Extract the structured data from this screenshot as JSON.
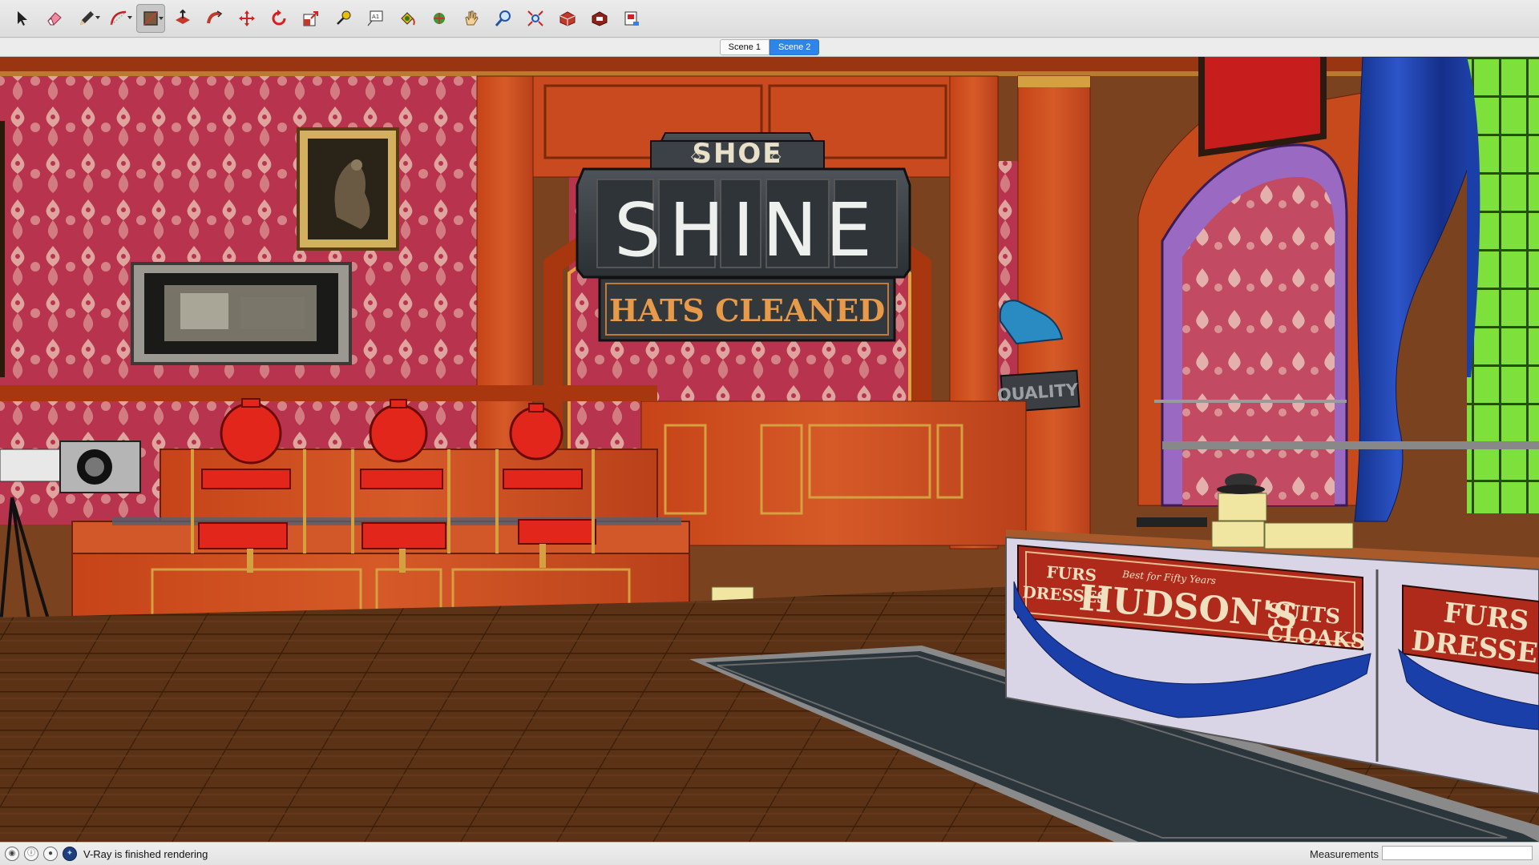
{
  "toolbar": {
    "tools": [
      {
        "name": "select",
        "icon": "select-arrow-icon"
      },
      {
        "name": "eraser",
        "icon": "eraser-icon"
      },
      {
        "name": "line",
        "icon": "pencil-line-icon"
      },
      {
        "name": "arc",
        "icon": "arc-icon"
      },
      {
        "name": "shapes",
        "icon": "rectangle-shape-icon"
      },
      {
        "name": "push-pull",
        "icon": "push-pull-icon"
      },
      {
        "name": "follow-me",
        "icon": "follow-me-icon"
      },
      {
        "name": "move",
        "icon": "move-arrows-icon"
      },
      {
        "name": "rotate",
        "icon": "rotate-icon"
      },
      {
        "name": "scale",
        "icon": "scale-icon"
      },
      {
        "name": "tape-measure",
        "icon": "tape-measure-icon"
      },
      {
        "name": "text",
        "icon": "text-tool-icon"
      },
      {
        "name": "paint-bucket",
        "icon": "paint-bucket-icon"
      },
      {
        "name": "orbit",
        "icon": "orbit-icon"
      },
      {
        "name": "pan",
        "icon": "pan-hand-icon"
      },
      {
        "name": "zoom",
        "icon": "zoom-magnifier-icon"
      },
      {
        "name": "zoom-extents",
        "icon": "zoom-extents-icon"
      },
      {
        "name": "warehouse",
        "icon": "3d-warehouse-icon"
      },
      {
        "name": "extension-warehouse",
        "icon": "extension-warehouse-icon"
      },
      {
        "name": "layout",
        "icon": "send-to-layout-icon"
      }
    ]
  },
  "scenes": {
    "tab1": "Scene 1",
    "tab2": "Scene 2"
  },
  "viewport": {
    "sign_top": "SHOE",
    "sign_main": "SHINE",
    "sign_bottom": "HATS CLEANED",
    "quality_sign": "QUALITY",
    "counter_brand": "HUDSON'S",
    "counter_tagline": "Best for Fifty Years",
    "counter_left_1": "FURS",
    "counter_left_2": "DRESSES",
    "counter_right_1": "SUITS",
    "counter_right_2": "CLOAKS",
    "counter2_line1": "FURS",
    "counter2_line2": "DRESSES"
  },
  "status": {
    "message": "V-Ray is finished rendering",
    "measurements_label": "Measurements",
    "measurements_value": ""
  },
  "colors": {
    "wood": "#c9471c",
    "wallpaper": "#b8344e",
    "floor": "#5a3216",
    "accent_blue": "#2f84ea",
    "curtain": "#1b3fa8",
    "window_green": "#7ee03a"
  }
}
